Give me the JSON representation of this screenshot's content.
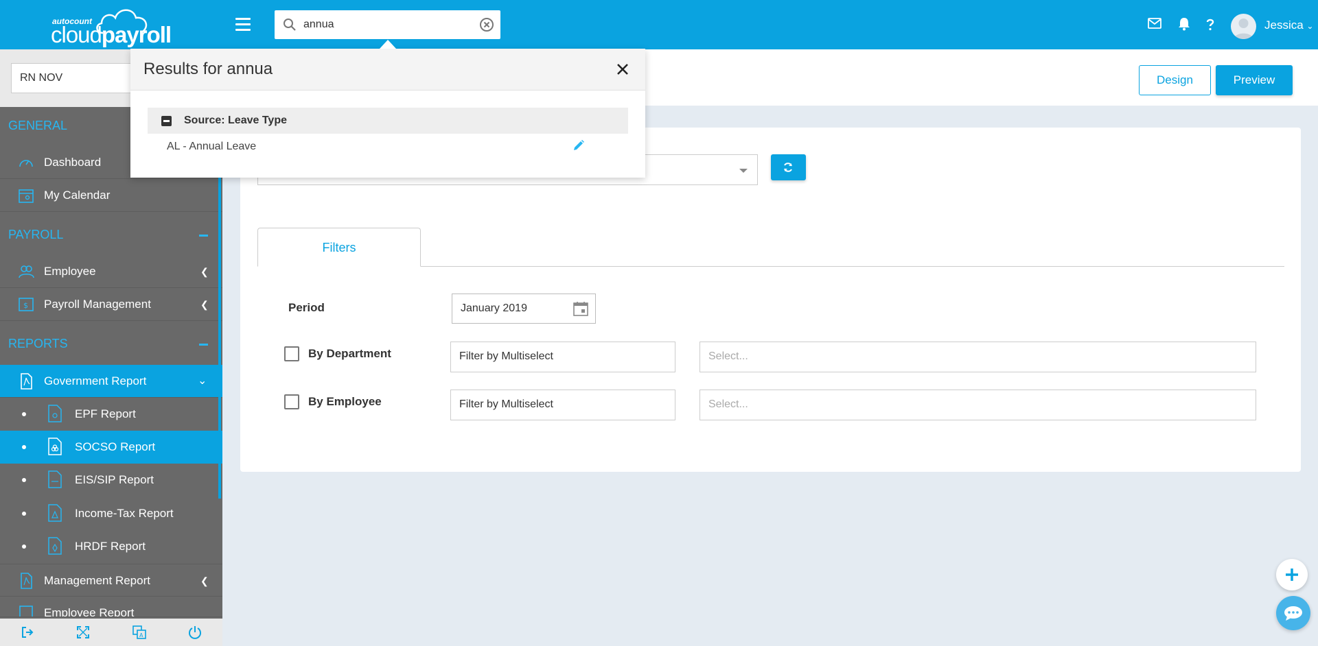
{
  "app": {
    "brand_small": "autocount",
    "brand_main_light": "cloud",
    "brand_main_bold": "payroll"
  },
  "topbar": {
    "search_value": "annua",
    "user_name": "Jessica",
    "icons": [
      "mail-icon",
      "bell-icon",
      "help-icon",
      "avatar",
      "chevron-down-icon"
    ]
  },
  "search_results": {
    "title": "Results for annua",
    "group_label": "Source: Leave Type",
    "items": [
      {
        "label": "AL - Annual Leave"
      }
    ]
  },
  "sidebar": {
    "company": "RN NOV",
    "sections": {
      "general": "GENERAL",
      "payroll": "PAYROLL",
      "reports": "REPORTS"
    },
    "items": {
      "dashboard": "Dashboard",
      "my_calendar": "My Calendar",
      "employee": "Employee",
      "payroll_management": "Payroll Management",
      "government_report": "Government Report",
      "epf_report": "EPF Report",
      "socso_report": "SOCSO Report",
      "eis_sip_report": "EIS/SIP Report",
      "income_tax_report": "Income-Tax Report",
      "hrdf_report": "HRDF Report",
      "management_report": "Management Report",
      "employee_report": "Employee Report"
    }
  },
  "header": {
    "design_label": "Design",
    "preview_label": "Preview"
  },
  "filters": {
    "tab_label": "Filters",
    "period_label": "Period",
    "period_value": "January 2019",
    "by_department_label": "By Department",
    "by_employee_label": "By Employee",
    "multiselect_value": "Filter by Multiselect",
    "select_placeholder": "Select..."
  },
  "colors": {
    "accent": "#0aa3e0",
    "sidebar_bg": "#696969",
    "page_bg": "#e4ebf2"
  }
}
